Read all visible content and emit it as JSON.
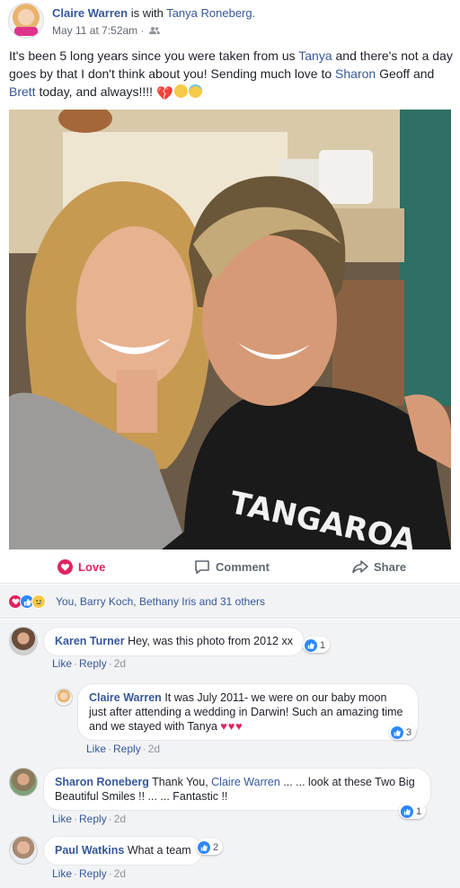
{
  "post": {
    "author": "Claire Warren",
    "with_text": "is with",
    "tagged": "Tanya Roneberg.",
    "date": "May 11 at 7:52am ·",
    "text_parts": {
      "p1": "It's been 5 long years since you were taken from us ",
      "tanya": "Tanya",
      "p2": " and there's not a day goes by that I don't think about you! Sending much love to ",
      "sharon": "Sharon",
      "p3": " Geoff and ",
      "brett": "Brett",
      "p4": " today, and always!!!! "
    },
    "photo_text": "TANGAROA"
  },
  "actions": {
    "love": "Love",
    "comment": "Comment",
    "share": "Share"
  },
  "reactions": {
    "summary": "You, Barry Koch, Bethany Iris and 31 others"
  },
  "comments": [
    {
      "author": "Karen Turner",
      "text": "Hey, was this photo from 2012 xx",
      "like_label": "Like",
      "reply_label": "Reply",
      "time": "2d",
      "likes": "1"
    },
    {
      "author": "Claire Warren",
      "text": "It was July 2011- we were on our baby moon just after attending a wedding in Darwin! Such an amazing time and we stayed with Tanya",
      "hearts": "♥♥♥",
      "like_label": "Like",
      "reply_label": "Reply",
      "time": "2d",
      "likes": "3"
    },
    {
      "author": "Sharon Roneberg",
      "text_a": "Thank You, ",
      "mention": "Claire Warren",
      "text_b": " ... ... look at these Two Big Beautiful Smiles !! ... ... Fantastic !!",
      "like_label": "Like",
      "reply_label": "Reply",
      "time": "2d",
      "likes": "1"
    },
    {
      "author": "Paul Watkins",
      "text": "What a team",
      "like_label": "Like",
      "reply_label": "Reply",
      "time": "2d",
      "likes": "2"
    }
  ],
  "colors": {
    "link": "#365899",
    "love": "#e0245e",
    "like_blue": "#2d88ff",
    "comments_bg": "#f2f3f5"
  }
}
